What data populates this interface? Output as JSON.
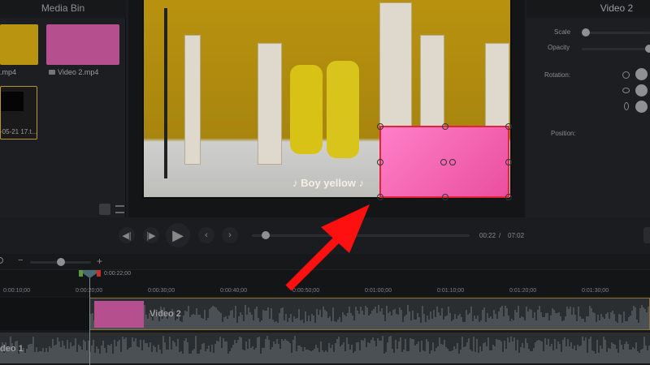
{
  "media_bin": {
    "title": "Media Bin",
    "items": [
      {
        "label": ".mp4"
      },
      {
        "label": "Video 2.mp4"
      },
      {
        "label": "-05-21 17.t..."
      }
    ]
  },
  "preview": {
    "caption": "♪ Boy yellow ♪"
  },
  "properties": {
    "title": "Video 2",
    "scale_label": "Scale",
    "opacity_label": "Opacity",
    "rotation_label": "Rotation:",
    "position_label": "Position:",
    "scale_value": 0.05,
    "opacity_value": 1.0
  },
  "transport": {
    "current_time": "00:22",
    "separator": "/",
    "total_time": "07:02",
    "progress": 0.052
  },
  "timeline": {
    "playhead_time": "0:00:22;00",
    "ticks": [
      "0:00:10;00",
      "0:00:20;00",
      "0:00:30;00",
      "0:00:40;00",
      "0:00:50;00",
      "0:01:00;00",
      "0:01:10;00",
      "0:01:20;00",
      "0:01:30;00"
    ],
    "zoom_minus": "−",
    "zoom_plus": "+",
    "tracks": [
      {
        "label": "Video 2"
      },
      {
        "label": "deo 1"
      }
    ]
  },
  "colors": {
    "accent_pink": "#f06aae",
    "selection_red": "#e0243a",
    "arrow": "#ff1010"
  }
}
